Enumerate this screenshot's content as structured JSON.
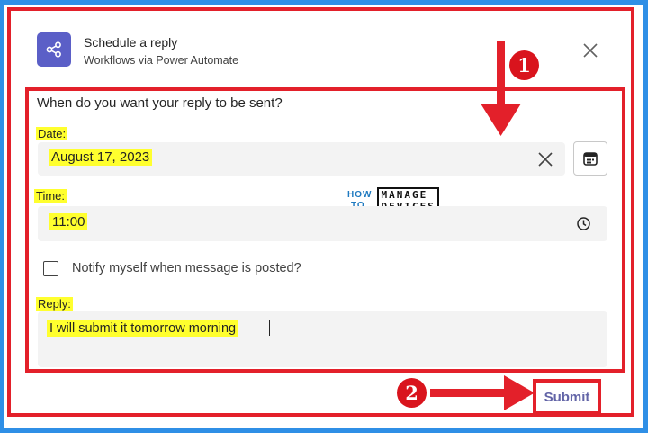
{
  "dialog": {
    "title": "Schedule a reply",
    "subtitle": "Workflows via Power Automate",
    "app_icon": "share-nodes-icon",
    "close_icon": "close-icon"
  },
  "form": {
    "question": "When do you want your reply to be sent?",
    "date_label": "Date:",
    "date_value": "August 17, 2023",
    "time_label": "Time:",
    "time_value": "11:00",
    "notify_label": "Notify myself when message is posted?",
    "notify_checked": false,
    "reply_label": "Reply:",
    "reply_value": "I will submit it tomorrow morning"
  },
  "watermark": {
    "how": "HOW",
    "to": "TO",
    "manage": "MANAGE",
    "devices": "DEVICES"
  },
  "annotations": {
    "step1": "1",
    "step2": "2"
  },
  "footer": {
    "submit_label": "Submit"
  },
  "colors": {
    "background": "#2f8fe6",
    "accent": "#5b5fc7",
    "annotation_red": "#e3202a",
    "highlight": "#ffff2e",
    "submit_text": "#6264a7"
  }
}
